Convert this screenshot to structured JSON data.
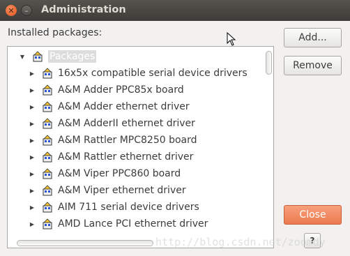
{
  "window": {
    "title": "Administration"
  },
  "labels": {
    "installed_packages": "Installed packages:"
  },
  "tree": {
    "root_label": "Packages",
    "root_expanded": true,
    "items": [
      "16x5x compatible serial device drivers",
      "A&M Adder PPC85x board",
      "A&M Adder ethernet driver",
      "A&M AdderII ethernet driver",
      "A&M Rattler MPC8250 board",
      "A&M Rattler ethernet driver",
      "A&M Viper PPC860 board",
      "A&M Viper ethernet driver",
      "AIM 711 serial device drivers",
      "AMD Lance PCI ethernet driver"
    ]
  },
  "buttons": {
    "add": "Add...",
    "remove": "Remove",
    "close": "Close",
    "help": "?"
  },
  "watermark": "http://blog.csdn.net/zoomdy",
  "colors": {
    "close_button": "#ec7a50",
    "titlebar": "#3d3c38",
    "root_highlight": "#dcdcdc"
  },
  "icons": {
    "package": "package-icon",
    "expander": "triangle-expander-icon",
    "window_close": "close-icon",
    "window_minimize": "minimize-icon"
  }
}
